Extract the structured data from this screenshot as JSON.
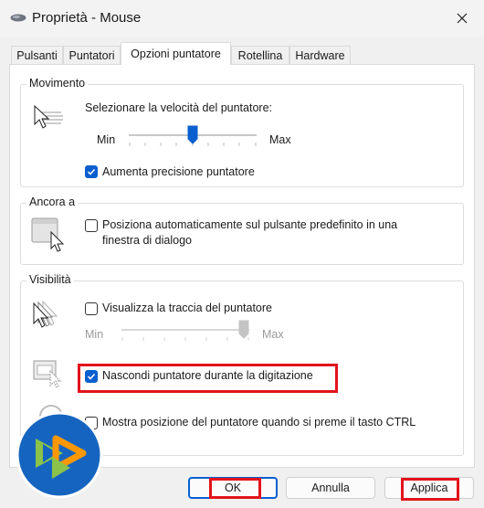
{
  "window": {
    "title": "Proprietà - Mouse",
    "close_icon": "close-icon"
  },
  "tabs": [
    {
      "label": "Pulsanti",
      "active": false
    },
    {
      "label": "Puntatori",
      "active": false
    },
    {
      "label": "Opzioni puntatore",
      "active": true
    },
    {
      "label": "Rotellina",
      "active": false
    },
    {
      "label": "Hardware",
      "active": false
    }
  ],
  "movimento": {
    "title": "Movimento",
    "speed_label": "Selezionare la velocità del puntatore:",
    "min": "Min",
    "max": "Max",
    "speed_value": 0.5,
    "precision_label": "Aumenta precisione puntatore",
    "precision_checked": true
  },
  "ancora": {
    "title": "Ancora a",
    "snap_line1": "Posiziona automaticamente sul pulsante predefinito in una",
    "snap_line2": "finestra di dialogo",
    "snap_checked": false
  },
  "visibilita": {
    "title": "Visibilità",
    "trail_label": "Visualizza la traccia del puntatore",
    "trail_checked": false,
    "trail_min": "Min",
    "trail_max": "Max",
    "trail_value": 1.0,
    "hide_label": "Nascondi puntatore durante la digitazione",
    "hide_checked": true,
    "ctrl_label": "Mostra posizione del puntatore quando si preme il tasto CTRL",
    "ctrl_checked": false
  },
  "buttons": {
    "ok": "OK",
    "cancel": "Annulla",
    "apply": "Applica"
  },
  "colors": {
    "accent": "#0a5fcf",
    "highlight": "#e3131b",
    "logo_bg": "#1565c0"
  }
}
